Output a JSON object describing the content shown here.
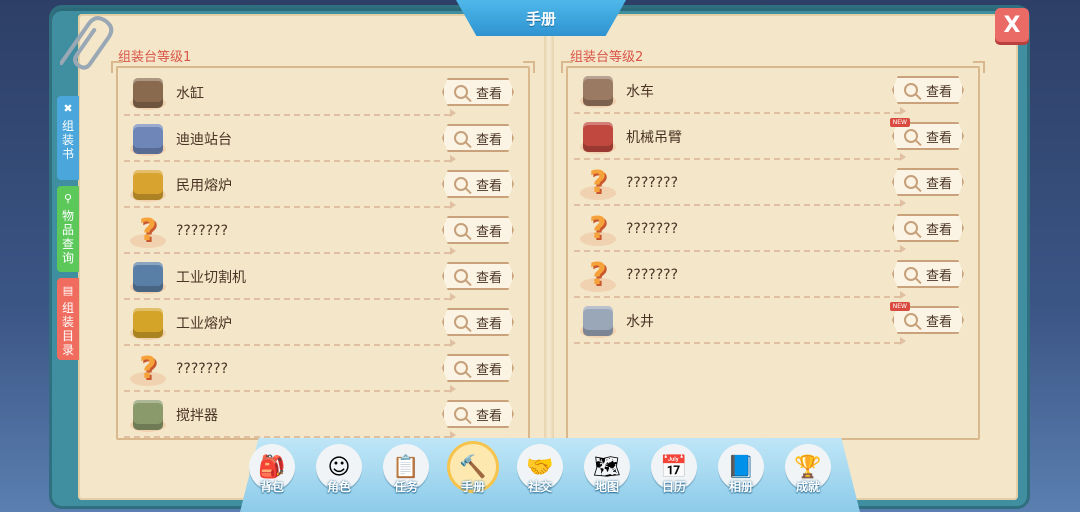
{
  "title": "手册",
  "close_label": "X",
  "side_tabs": [
    {
      "label": "组装书",
      "icon": "wrench-icon",
      "color": "#4aa6db"
    },
    {
      "label": "物品查询",
      "icon": "magnifier-icon",
      "color": "#5dc85a"
    },
    {
      "label": "组装目录",
      "icon": "book-icon",
      "color": "#ef6c5e"
    }
  ],
  "left_section": {
    "title": "组装台等级1",
    "items": [
      {
        "name": "水缸",
        "icon": "water-tank-icon",
        "new": false,
        "unknown": false,
        "color": "#8a6a4e"
      },
      {
        "name": "迪迪站台",
        "icon": "station-icon",
        "new": false,
        "unknown": false,
        "color": "#6f86b8"
      },
      {
        "name": "民用熔炉",
        "icon": "furnace-icon",
        "new": false,
        "unknown": false,
        "color": "#d8a32f"
      },
      {
        "name": "???????",
        "icon": "question-mark-icon",
        "new": false,
        "unknown": true
      },
      {
        "name": "工业切割机",
        "icon": "cutter-icon",
        "new": false,
        "unknown": false,
        "color": "#5a7fa6"
      },
      {
        "name": "工业熔炉",
        "icon": "industrial-furnace-icon",
        "new": false,
        "unknown": false,
        "color": "#d4a428"
      },
      {
        "name": "???????",
        "icon": "question-mark-icon",
        "new": false,
        "unknown": true
      },
      {
        "name": "搅拌器",
        "icon": "mixer-icon",
        "new": false,
        "unknown": false,
        "color": "#8a9a6a"
      }
    ]
  },
  "right_section": {
    "title": "组装台等级2",
    "items": [
      {
        "name": "水车",
        "icon": "water-wheel-icon",
        "new": false,
        "unknown": false,
        "color": "#9a7a62"
      },
      {
        "name": "机械吊臂",
        "icon": "crane-arm-icon",
        "new": true,
        "unknown": false,
        "color": "#c0483e"
      },
      {
        "name": "???????",
        "icon": "question-mark-icon",
        "new": false,
        "unknown": true
      },
      {
        "name": "???????",
        "icon": "question-mark-icon",
        "new": false,
        "unknown": true
      },
      {
        "name": "???????",
        "icon": "question-mark-icon",
        "new": false,
        "unknown": true
      },
      {
        "name": "水井",
        "icon": "well-icon",
        "new": true,
        "unknown": false,
        "color": "#9aa7b8"
      }
    ]
  },
  "view_label": "查看",
  "new_label": "NEW",
  "nav": [
    {
      "label": "背包",
      "icon": "backpack-icon",
      "glyph": "🎒",
      "active": false
    },
    {
      "label": "角色",
      "icon": "character-icon",
      "glyph": "☺",
      "active": false
    },
    {
      "label": "任务",
      "icon": "quest-icon",
      "glyph": "📋",
      "active": false
    },
    {
      "label": "手册",
      "icon": "hammer-icon",
      "glyph": "🔨",
      "active": true
    },
    {
      "label": "社交",
      "icon": "handshake-icon",
      "glyph": "🤝",
      "active": false
    },
    {
      "label": "地图",
      "icon": "map-icon",
      "glyph": "🗺",
      "active": false
    },
    {
      "label": "日历",
      "icon": "calendar-icon",
      "glyph": "📅",
      "active": false
    },
    {
      "label": "相册",
      "icon": "album-icon",
      "glyph": "📘",
      "active": false
    },
    {
      "label": "成就",
      "icon": "trophy-icon",
      "glyph": "🏆",
      "active": false
    }
  ]
}
